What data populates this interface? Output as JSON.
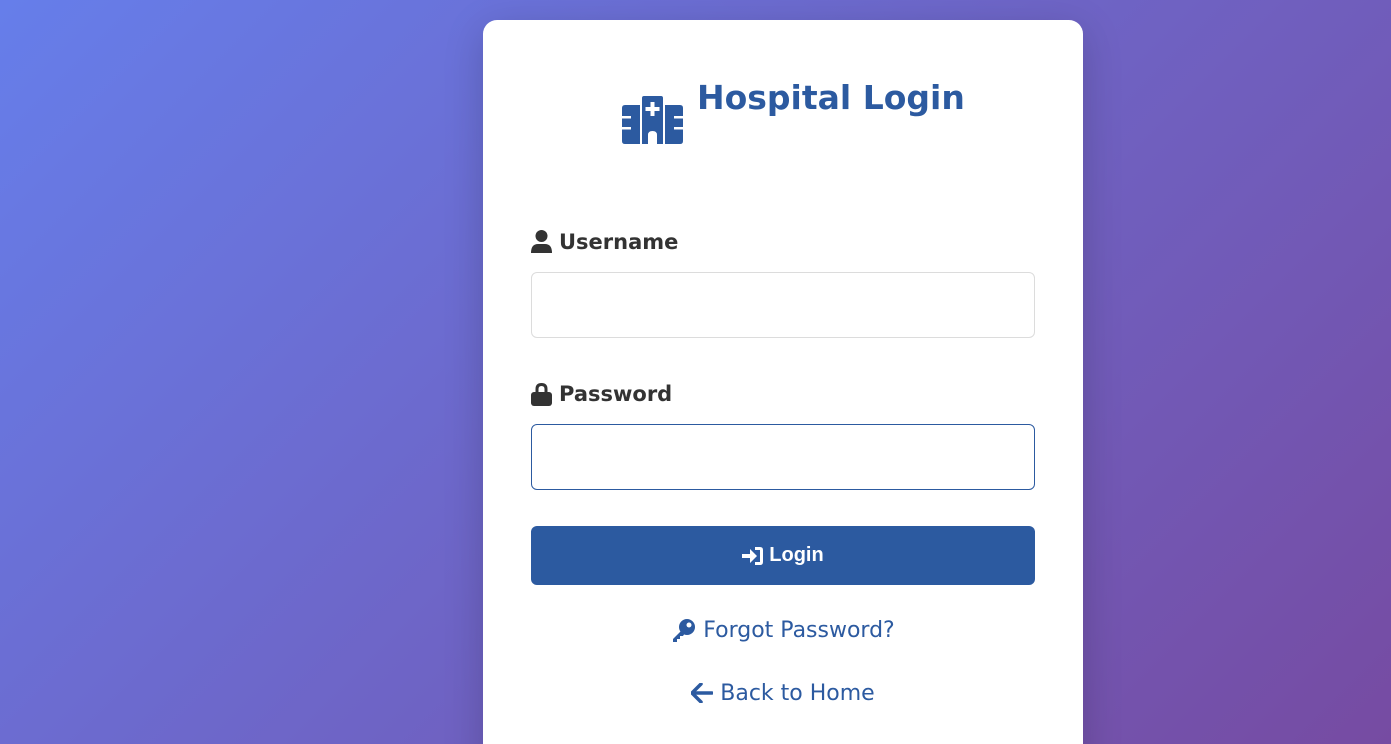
{
  "login": {
    "title": "Hospital Login",
    "username_label": "Username",
    "username_value": "",
    "password_label": "Password",
    "password_value": "",
    "submit_label": "Login",
    "forgot_label": "Forgot Password?",
    "home_label": "Back to Home"
  },
  "icons": {
    "logo": "hospital-icon",
    "username": "user-icon",
    "password": "lock-icon",
    "submit": "sign-in-icon",
    "forgot": "key-icon",
    "home": "arrow-left-icon"
  },
  "colors": {
    "primary": "#2c5aa0",
    "label_text": "#333333",
    "background_gradient_start": "#667eea",
    "background_gradient_end": "#764ba2"
  }
}
